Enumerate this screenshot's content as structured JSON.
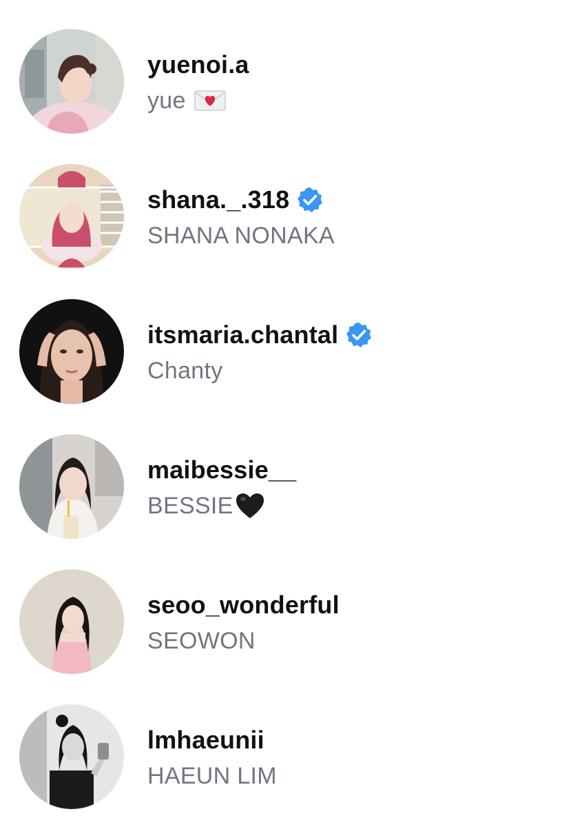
{
  "accounts": [
    {
      "handle": "yuenoi.a",
      "name": "yue",
      "verified": false,
      "name_emoji": "envelope-heart-icon",
      "avatar": "avatar-photo"
    },
    {
      "handle": "shana._.318",
      "name": "SHANA NONAKA",
      "verified": true,
      "name_emoji": null,
      "avatar": "avatar-photo"
    },
    {
      "handle": "itsmaria.chantal",
      "name": "Chanty",
      "verified": true,
      "name_emoji": null,
      "avatar": "avatar-photo"
    },
    {
      "handle": "maibessie__",
      "name": "BESSIE",
      "verified": false,
      "name_emoji": "black-heart-icon",
      "avatar": "avatar-photo"
    },
    {
      "handle": "seoo_wonderful",
      "name": "SEOWON",
      "verified": false,
      "name_emoji": null,
      "avatar": "avatar-photo"
    },
    {
      "handle": "lmhaeunii",
      "name": "HAEUN LIM",
      "verified": false,
      "name_emoji": null,
      "avatar": "avatar-photo"
    }
  ],
  "colors": {
    "handle": "#111111",
    "name": "#6f7580",
    "verified_badge": "#3897f0",
    "background": "#ffffff"
  }
}
